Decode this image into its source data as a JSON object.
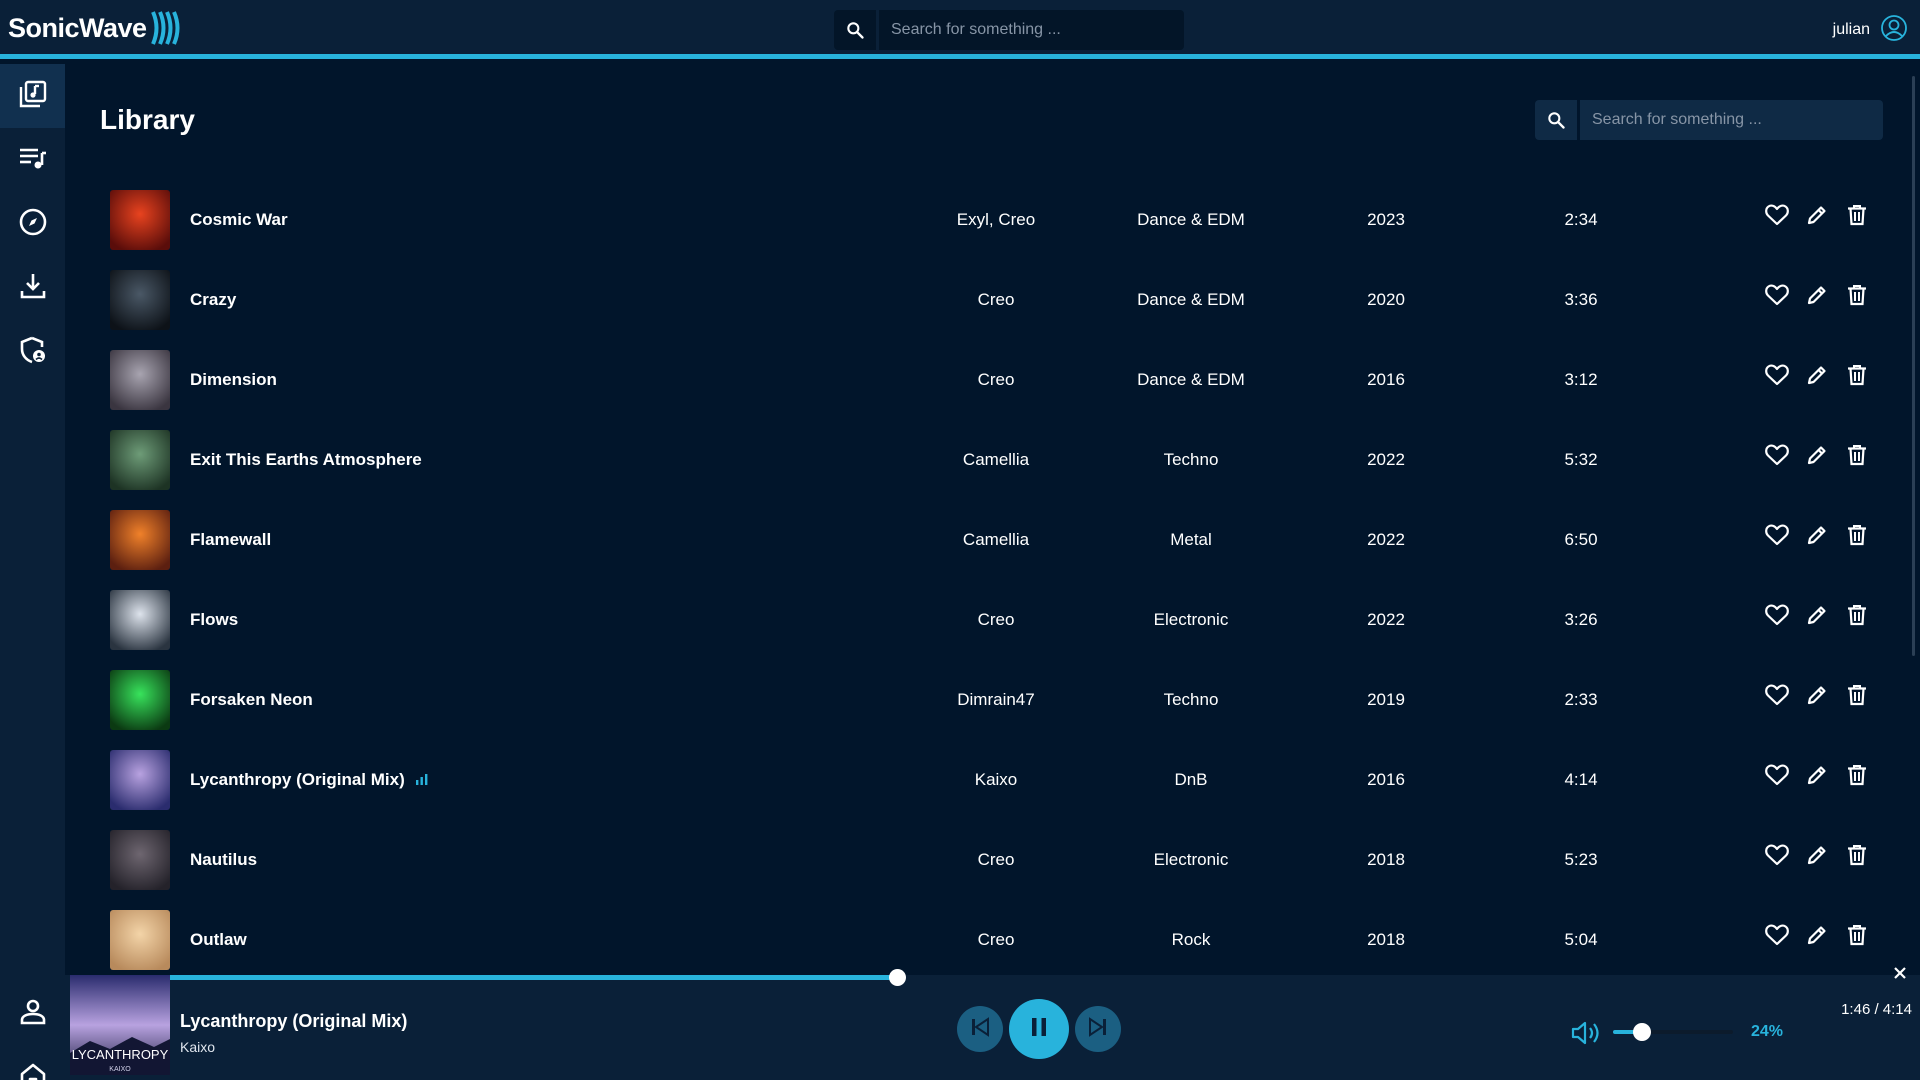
{
  "app": {
    "name": "SonicWave",
    "accent_color": "#28b3dc",
    "background_color": "#01152b",
    "panel_color": "#0a2038"
  },
  "header": {
    "search_placeholder": "Search for something ...",
    "username": "julian",
    "user_icon": "account-circle-icon"
  },
  "sidebar": {
    "items": [
      {
        "name": "library",
        "icon": "music-library-icon",
        "active": true
      },
      {
        "name": "playlists",
        "icon": "playlist-icon",
        "active": false
      },
      {
        "name": "explore",
        "icon": "compass-icon",
        "active": false
      },
      {
        "name": "downloads",
        "icon": "download-icon",
        "active": false
      },
      {
        "name": "admin",
        "icon": "shield-user-icon",
        "active": false
      },
      {
        "name": "account",
        "icon": "person-icon",
        "active": false
      },
      {
        "name": "home",
        "icon": "home-icon",
        "active": false
      }
    ]
  },
  "library": {
    "title": "Library",
    "search_placeholder": "Search for something ...",
    "tracks": [
      {
        "title": "Cosmic War",
        "artist": "Exyl, Creo",
        "genre": "Dance & EDM",
        "year": "2023",
        "duration": "2:34",
        "playing": false,
        "cover": [
          "#e8431f",
          "#5a0d0a"
        ]
      },
      {
        "title": "Crazy",
        "artist": "Creo",
        "genre": "Dance & EDM",
        "year": "2020",
        "duration": "3:36",
        "playing": false,
        "cover": [
          "#4a5866",
          "#0d1218"
        ]
      },
      {
        "title": "Dimension",
        "artist": "Creo",
        "genre": "Dance & EDM",
        "year": "2016",
        "duration": "3:12",
        "playing": false,
        "cover": [
          "#a8a4b0",
          "#3a3540"
        ]
      },
      {
        "title": "Exit This Earths Atmosphere",
        "artist": "Camellia",
        "genre": "Techno",
        "year": "2022",
        "duration": "5:32",
        "playing": false,
        "cover": [
          "#6e9c78",
          "#1d3324"
        ]
      },
      {
        "title": "Flamewall",
        "artist": "Camellia",
        "genre": "Metal",
        "year": "2022",
        "duration": "6:50",
        "playing": false,
        "cover": [
          "#f0812a",
          "#5c1f10"
        ]
      },
      {
        "title": "Flows",
        "artist": "Creo",
        "genre": "Electronic",
        "year": "2022",
        "duration": "3:26",
        "playing": false,
        "cover": [
          "#dde3ec",
          "#2a3440"
        ]
      },
      {
        "title": "Forsaken Neon",
        "artist": "Dimrain47",
        "genre": "Techno",
        "year": "2019",
        "duration": "2:33",
        "playing": false,
        "cover": [
          "#38e35c",
          "#0b3a12"
        ]
      },
      {
        "title": "Lycanthropy (Original Mix)",
        "artist": "Kaixo",
        "genre": "DnB",
        "year": "2016",
        "duration": "4:14",
        "playing": true,
        "cover": [
          "#b8a2e0",
          "#2a2c6e"
        ]
      },
      {
        "title": "Nautilus",
        "artist": "Creo",
        "genre": "Electronic",
        "year": "2018",
        "duration": "5:23",
        "playing": false,
        "cover": [
          "#6e6670",
          "#24222a"
        ]
      },
      {
        "title": "Outlaw",
        "artist": "Creo",
        "genre": "Rock",
        "year": "2018",
        "duration": "5:04",
        "playing": false,
        "cover": [
          "#f3d4a8",
          "#b88a5c"
        ]
      }
    ]
  },
  "player": {
    "title": "Lycanthropy (Original Mix)",
    "artist": "Kaixo",
    "cover_text": "LYCANTHROPY",
    "cover_subtext": "KAIXO",
    "progress_fraction": 0.417,
    "elapsed": "1:46",
    "total": "4:14",
    "time_readout": "1:46 / 4:14",
    "volume_percent": 24,
    "volume_label": "24%"
  }
}
